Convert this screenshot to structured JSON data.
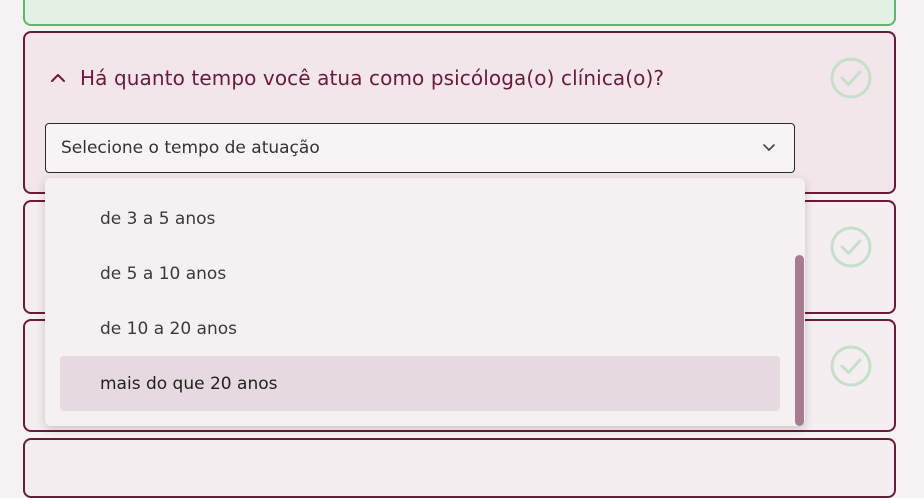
{
  "question": {
    "title": "Há quanto tempo você atua como psicóloga(o) clínica(o)?",
    "select": {
      "placeholder": "Selecione o tempo de atuação"
    },
    "options": [
      "de 3 a 5 anos",
      "de 5 a 10 anos",
      "de 10 a 20 anos",
      "mais do que 20 anos"
    ],
    "highlighted_option": "mais do que 20 anos"
  },
  "colors": {
    "accent": "#6b1a3c",
    "check": "#b7d8bd",
    "highlight": "#e6d9df",
    "scrollbar": "#a87c8e",
    "completed_border": "#5cb86a"
  },
  "icons": {
    "collapse": "chevron-up-icon",
    "dropdown": "chevron-down-icon",
    "status": "check-circle-icon"
  }
}
